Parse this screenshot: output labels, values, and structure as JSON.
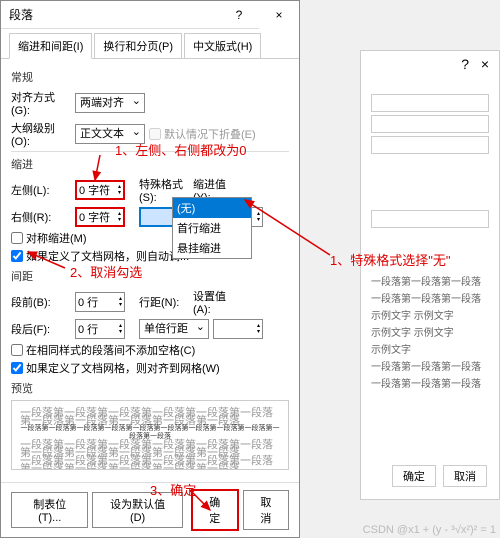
{
  "dialog": {
    "title": "段落",
    "help_icon": "?",
    "close_icon": "×",
    "tabs": [
      "缩进和间距(I)",
      "换行和分页(P)",
      "中文版式(H)"
    ],
    "groups": {
      "general": "常规",
      "indent": "缩进",
      "spacing": "间距",
      "preview": "预览"
    },
    "labels": {
      "alignment": "对齐方式(G):",
      "outline": "大纲级别(O):",
      "collapsed": "默认情况下折叠(E)",
      "left": "左侧(L):",
      "right": "右侧(R):",
      "special": "特殊格式(S):",
      "indentby": "缩进值(Y):",
      "mirror": "对称缩进(M)",
      "autogrid_indent": "如果定义了文档网格，则自动调...",
      "before": "段前(B):",
      "after": "段后(F):",
      "linespace": "行距(N):",
      "setvalue": "设置值(A):",
      "nospace": "在相同样式的段落间不添加空格(C)",
      "snapgrid": "如果定义了文档网格，则对齐到网格(W)"
    },
    "values": {
      "alignment": "两端对齐",
      "outline": "正文文本",
      "left": "0 字符",
      "right": "0 字符",
      "before": "0 行",
      "after": "0 行",
      "linespace": "单倍行距"
    },
    "dropdown": {
      "none": "(无)",
      "firstline": "首行缩进",
      "hanging": "悬挂缩进"
    },
    "footer": {
      "tabs": "制表位(T)...",
      "default": "设为默认值(D)",
      "ok": "确定",
      "cancel": "取消"
    },
    "preview_text": "一段落第一段落第一段落第一段落第一段落第一段落第一段落第一段落第一段落第一段落第一段落"
  },
  "annotations": {
    "a1": "1、左侧、右侧都改为0",
    "a2": "2、取消勾选",
    "a3": "1、特殊格式选择\"无\"",
    "a4": "3、确定"
  },
  "background": {
    "close": "×",
    "help": "?",
    "t1": "示例文字 示例文字",
    "t2": "示例文字 示例文字",
    "t3": "示例文字",
    "p": "一段落第一段落第一段落",
    "ok": "确定",
    "cancel": "取消"
  },
  "watermark": "CSDN @x1 + (y - ³√x²)² = 1",
  "checks": {
    "autogrid_indent": true,
    "snapgrid": true,
    "mirror": false,
    "nospace": false
  }
}
